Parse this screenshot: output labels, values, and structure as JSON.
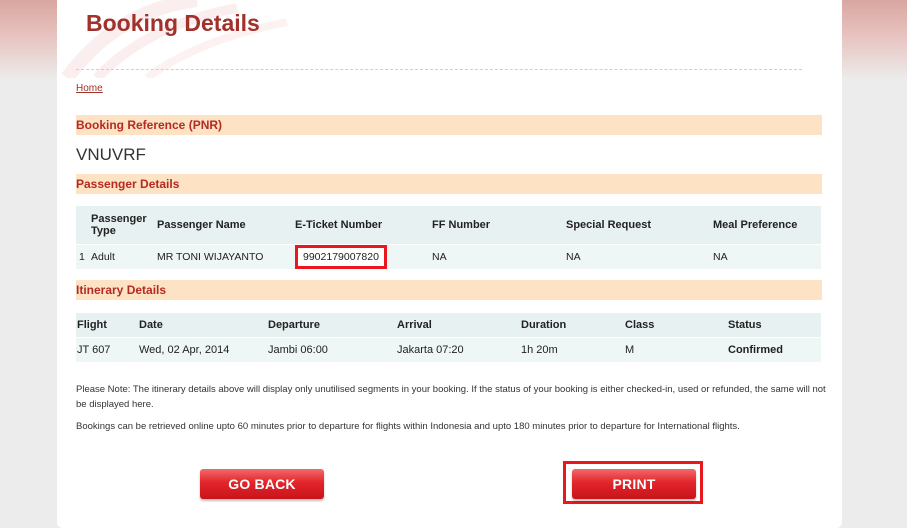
{
  "header": {
    "title": "Booking Details"
  },
  "breadcrumb": {
    "home": "Home"
  },
  "booking_reference": {
    "heading": "Booking Reference (PNR)",
    "value": "VNUVRF"
  },
  "passenger_details": {
    "heading": "Passenger Details",
    "columns": [
      "Passenger Type",
      "Passenger Name",
      "E-Ticket Number",
      "FF Number",
      "Special Request",
      "Meal Preference"
    ],
    "rows": [
      {
        "index": "1",
        "type": "Adult",
        "name": "MR TONI WIJAYANTO",
        "eticket": "9902179007820",
        "ff": "NA",
        "special": "NA",
        "meal": "NA"
      }
    ]
  },
  "itinerary": {
    "heading": "Itinerary Details",
    "columns": [
      "Flight",
      "Date",
      "Departure",
      "Arrival",
      "Duration",
      "Class",
      "Status"
    ],
    "rows": [
      {
        "flight": "JT 607",
        "date": "Wed, 02 Apr, 2014",
        "departure": "Jambi 06:00",
        "arrival": "Jakarta 07:20",
        "duration": "1h 20m",
        "class": "M",
        "status": "Confirmed"
      }
    ]
  },
  "notes": {
    "note1": "Please Note: The itinerary details above will display only unutilised segments in your booking. If the status of your booking is either checked-in, used or refunded, the same will not be displayed here.",
    "note2": "Bookings can be retrieved online upto 60 minutes prior to departure for flights within Indonesia and upto 180 minutes prior to departure for International flights."
  },
  "buttons": {
    "go_back": "GO BACK",
    "print": "PRINT"
  },
  "colors": {
    "brand_red": "#a1312b",
    "section_bg": "#fde3c4",
    "table_bg": "#eef6f6",
    "button_red": "#e3242b",
    "highlight": "#e8181e"
  }
}
